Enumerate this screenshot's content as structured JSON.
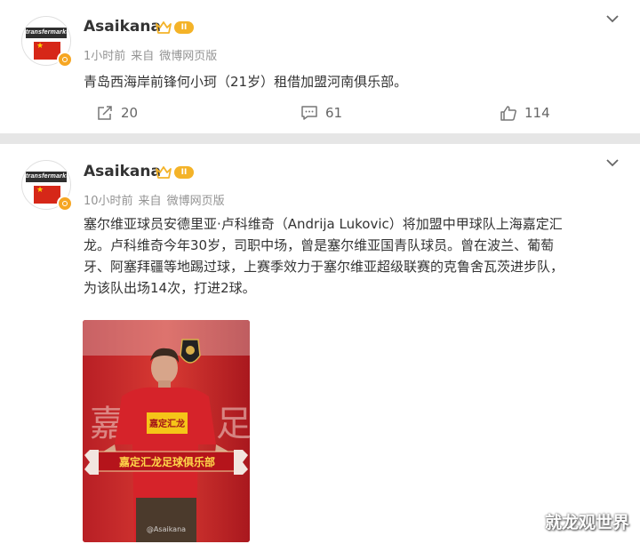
{
  "posts": [
    {
      "username": "Asaikana",
      "level": "II",
      "time": "1小时前",
      "source_prefix": "来自",
      "source": "微博网页版",
      "text": "青岛西海岸前锋何小珂（21岁）租借加盟河南俱乐部。",
      "reposts": "20",
      "comments": "61",
      "likes": "114",
      "avatar_text": "transfermarkt"
    },
    {
      "username": "Asaikana",
      "level": "II",
      "time": "10小时前",
      "source_prefix": "来自",
      "source": "微博网页版",
      "text_lines": [
        "塞尔维亚球员安德里亚·卢科维奇（Andrija Lukovic）将加盟中甲球队上海嘉定汇",
        "龙。卢科维奇今年30岁，司职中场，曾是塞尔维亚国青队球员。曾在波兰、葡萄",
        "牙、阿塞拜疆等地踢过球，上赛季效力于塞尔维亚超级联赛的克鲁舍瓦茨进步队，",
        "为该队出场14次，打进2球。"
      ],
      "avatar_text": "transfermarkt",
      "photo": {
        "scarf_text": "嘉定汇龙足球俱乐部",
        "bg_text": "嘉定",
        "bg_text_right": "足",
        "shirt_sponsor": "嘉定汇龙",
        "photo_credit": "@Asaikana"
      }
    }
  ],
  "watermark": "就龙观世界",
  "colors": {
    "page_bg": "#e6e6e6",
    "card_bg": "#ffffff",
    "text": "#333333",
    "meta": "#939393",
    "badge_orange": "#f6a623",
    "photo_red": "#c9242a"
  }
}
